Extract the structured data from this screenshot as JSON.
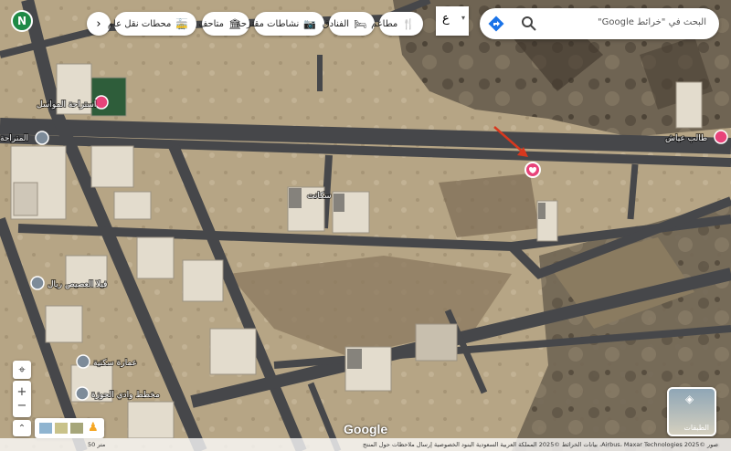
{
  "search": {
    "placeholder": "البحث في \"خرائط Google\""
  },
  "lang_toggle": "ع",
  "chips": [
    {
      "label": "مطاعم",
      "icon": "restaurant-icon"
    },
    {
      "label": "الفنادق",
      "icon": "hotel-icon"
    },
    {
      "label": "نشاطات مقترحة",
      "icon": "camera-icon"
    },
    {
      "label": "متاحف",
      "icon": "museum-icon"
    },
    {
      "label": "محطات نقل عام",
      "icon": "transit-icon"
    }
  ],
  "avatar_letter": "N",
  "map_labels": {
    "place_1": "استراحة المواسل",
    "place_2": "المتراحة",
    "place_3": "فيلا العصيص ريال",
    "place_4": "عمارة سكنية",
    "place_5": "مخطط وادي الحوزة",
    "place_6": "طالب عياش",
    "place_7": "سكانت"
  },
  "logo": "Google",
  "layers_label": "الطبقات",
  "attribution": "صور ©2025 Airbus، Maxar Technologies، بيانات الخرائط ©2025 المملكة العربية السعودية  البنود  الخصوصية  إرسال ملاحظات حول المنتج",
  "scale": "50 متر",
  "colors": {
    "marker_pink": "#e8437a",
    "avatar_green": "#1f8a46",
    "arrow_red": "#d8381e"
  }
}
